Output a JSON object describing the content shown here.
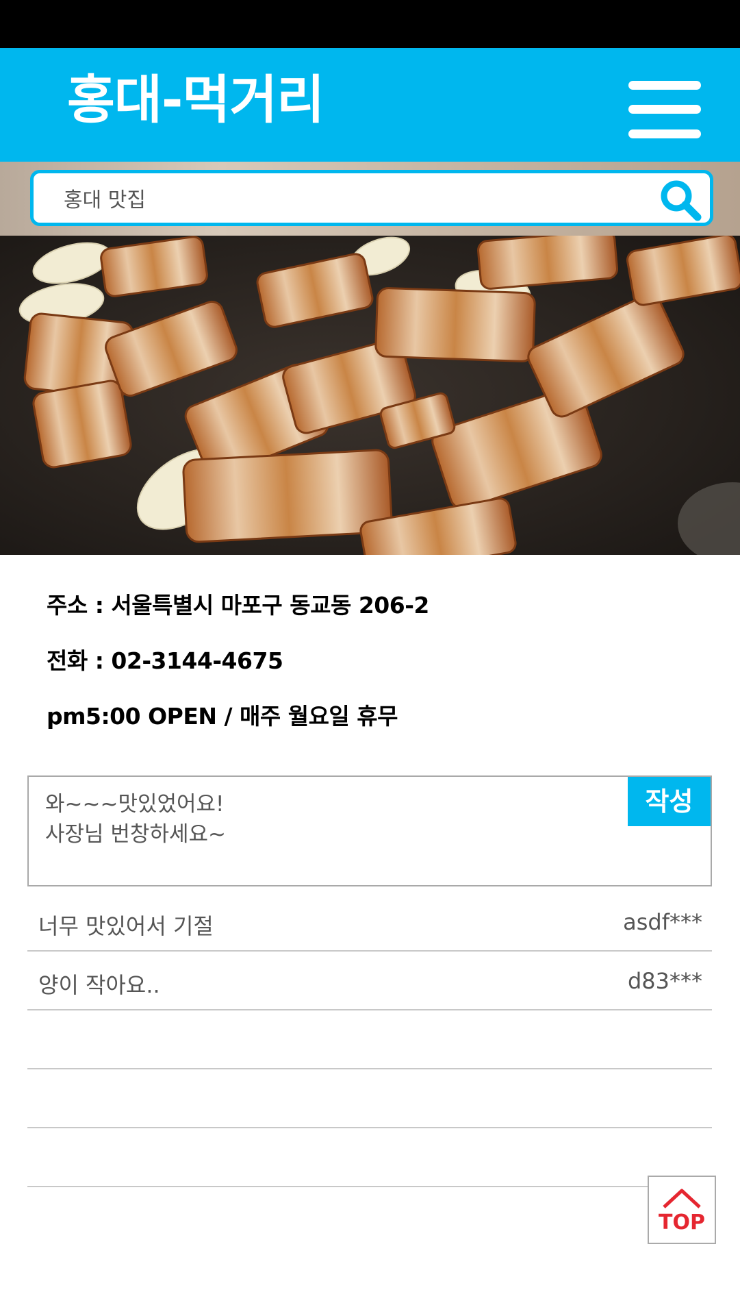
{
  "header": {
    "title": "홍대-먹거리",
    "menu_icon": "hamburger-menu-icon"
  },
  "search": {
    "value": "홍대 맛집",
    "icon": "search-icon"
  },
  "restaurant": {
    "address": "주소 : 서울특별시 마포구 동교동 206-2",
    "phone": "전화 : 02-3144-4675",
    "hours": "pm5:00 OPEN / 매주 월요일 휴무"
  },
  "comment": {
    "value": "와~~~맛있었어요!\n사장님 번창하세요~",
    "submit_label": "작성"
  },
  "reviews": [
    {
      "text": "너무 맛있어서 기절",
      "user": "asdf***"
    },
    {
      "text": "양이 작아요..",
      "user": "d83***"
    },
    {
      "text": "",
      "user": ""
    },
    {
      "text": "",
      "user": ""
    },
    {
      "text": "",
      "user": ""
    }
  ],
  "top_button": {
    "label": "TOP",
    "icon": "up-arrow-icon"
  },
  "colors": {
    "accent": "#00b7ee",
    "top_red": "#e52630"
  }
}
